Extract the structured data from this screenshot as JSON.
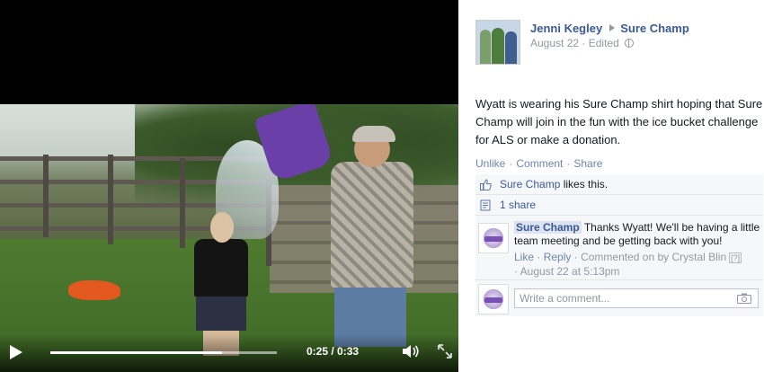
{
  "video": {
    "time_display": "0:25 / 0:33",
    "progress_fraction": 0.758
  },
  "post": {
    "author": "Jenni Kegley",
    "target": "Sure Champ",
    "date": "August 22",
    "edited": "Edited",
    "text": "Wyatt is wearing his Sure Champ shirt hoping that Sure Champ will join in the fun with the ice bucket challenge for ALS or make a donation.",
    "actions": {
      "unlike": "Unlike",
      "comment": "Comment",
      "share": "Share",
      "separator": "·"
    },
    "likes": {
      "name": "Sure Champ",
      "suffix": "likes this."
    },
    "shares": "1 share",
    "comment": {
      "author": "Sure Champ",
      "text": "Thanks Wyatt! We'll be having a little team meeting and be getting back with you!",
      "like": "Like",
      "reply": "Reply",
      "commented_by": "Commented on by Crystal Blin",
      "info": "[?]",
      "time": "August 22 at 5:13pm"
    },
    "write_comment_placeholder": "Write a comment..."
  },
  "icons": {
    "play": "play-icon",
    "volume": "volume-icon",
    "fullscreen": "fullscreen-icon",
    "like": "thumbs-up-icon",
    "share": "share-icon",
    "globe": "globe-icon",
    "camera": "camera-icon"
  },
  "colors": {
    "link": "#3b5998",
    "muted_link": "#6d84b4",
    "meta": "#9197a3",
    "ufi_bg": "#f6f7f8"
  }
}
